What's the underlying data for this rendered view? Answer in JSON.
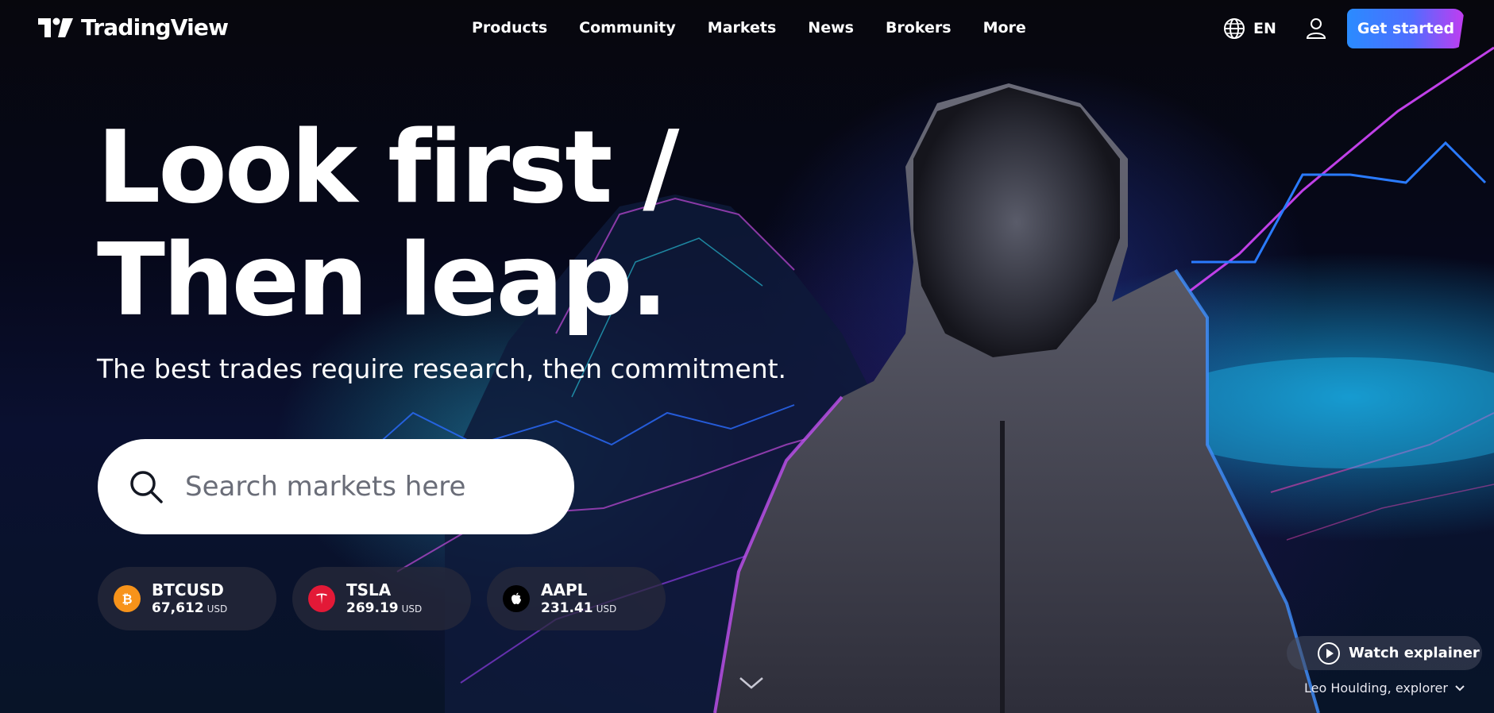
{
  "header": {
    "logo_text": "TradingView",
    "nav": [
      "Products",
      "Community",
      "Markets",
      "News",
      "Brokers",
      "More"
    ],
    "language": "EN",
    "cta_label": "Get started"
  },
  "hero": {
    "headline_line1": "Look first /",
    "headline_line2": "Then leap.",
    "subhead": "The best trades require research, then commitment.",
    "search_placeholder": "Search markets here"
  },
  "tickers": [
    {
      "symbol": "BTCUSD",
      "price": "67,612",
      "currency": "USD",
      "icon": "bitcoin-icon",
      "icon_color": "#f7931a"
    },
    {
      "symbol": "TSLA",
      "price": "269.19",
      "currency": "USD",
      "icon": "tesla-icon",
      "icon_color": "#e31937"
    },
    {
      "symbol": "AAPL",
      "price": "231.41",
      "currency": "USD",
      "icon": "apple-icon",
      "icon_color": "#000000"
    }
  ],
  "footer": {
    "watch_label": "Watch explainer",
    "credit": "Leo Houlding, explorer"
  },
  "colors": {
    "cta_gradient_start": "#2a8bff",
    "cta_gradient_end": "#c23cf0",
    "search_bg": "#ffffff"
  }
}
